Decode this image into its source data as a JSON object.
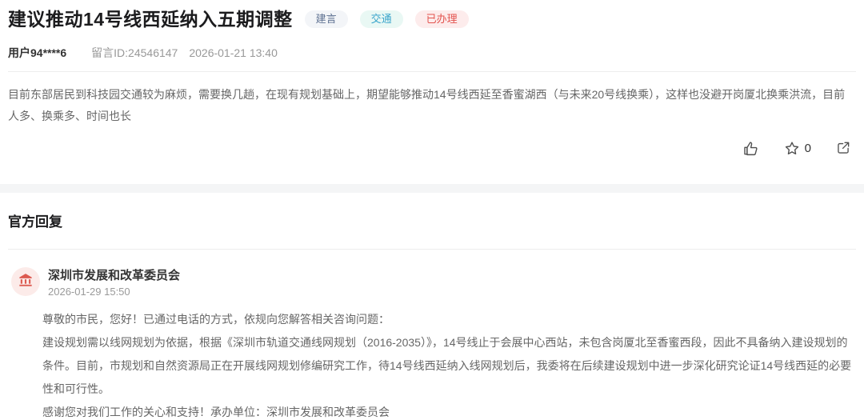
{
  "post": {
    "title": "建议推动14号线西延纳入五期调整",
    "tags": [
      {
        "label": "建言"
      },
      {
        "label": "交通"
      },
      {
        "label": "已办理"
      }
    ],
    "author": "用户94****6",
    "message_id": "留言ID:24546147",
    "date": "2026-01-21 13:40",
    "content": "目前东部居民到科技园交通较为麻烦，需要换几趟，在现有规划基础上，期望能够推动14号线西延至香蜜湖西（与未来20号线换乘），这样也没避开岗厦北换乘洪流，目前人多、换乘多、时间也长",
    "actions": {
      "like_icon": "thumbs-up-icon",
      "favorite_icon": "star-icon",
      "favorite_count": "0",
      "share_icon": "share-icon"
    }
  },
  "reply_section": {
    "heading": "官方回复",
    "reply": {
      "avatar_icon": "government-building-icon",
      "agency": "深圳市发展和改革委员会",
      "date": "2026-01-29 15:50",
      "paragraphs": [
        "尊敬的市民，您好！已通过电话的方式，依规向您解答相关咨询问题：",
        "建设规划需以线网规划为依据，根据《深圳市轨道交通线网规划（2016-2035）》，14号线止于会展中心西站，未包含岗厦北至香蜜西段，因此不具备纳入建设规划的条件。目前，市规划和自然资源局正在开展线网规划修编研究工作，待14号线西延纳入线网规划后，我委将在后续建设规划中进一步深化研究论证14号线西延的必要性和可行性。",
        "感谢您对我们工作的关心和支持！承办单位：深圳市发展和改革委员会"
      ]
    }
  },
  "colors": {
    "tag_suggestion_text": "#5f7292",
    "tag_suggestion_bg": "#f3f5f8",
    "tag_transport_text": "#3aa5cb",
    "tag_transport_bg": "#e9f8f4",
    "status_processed_text": "#e3534e",
    "status_processed_bg": "#fdecec",
    "avatar_bg": "#fcebe9",
    "avatar_icon": "#dc5a50",
    "section_gap_bg": "#f4f5f6"
  }
}
